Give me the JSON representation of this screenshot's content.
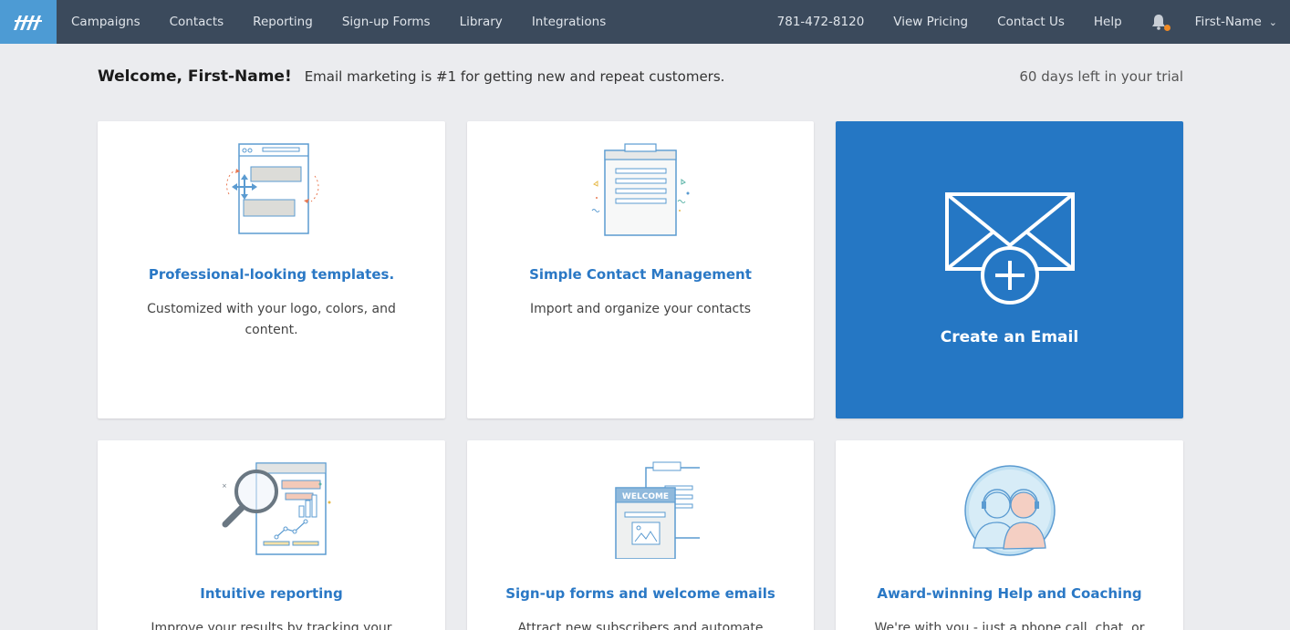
{
  "nav": {
    "left": [
      "Campaigns",
      "Contacts",
      "Reporting",
      "Sign-up Forms",
      "Library",
      "Integrations"
    ],
    "phone": "781-472-8120",
    "view_pricing": "View Pricing",
    "contact_us": "Contact Us",
    "help": "Help",
    "user": "First-Name",
    "logo_color": "#4d9bd4",
    "bar_color": "#3b4a5c",
    "notification_dot_color": "#f08a24"
  },
  "welcome": {
    "title": "Welcome, First-Name!",
    "subtitle": "Email marketing is #1 for getting new and repeat customers.",
    "trial": "60 days left in your trial"
  },
  "cards": {
    "templates": {
      "title": "Professional-looking templates.",
      "desc": "Customized with your logo, colors, and content.",
      "icon": "template-editor-icon"
    },
    "contacts": {
      "title": "Simple Contact Management",
      "desc": "Import and organize your contacts",
      "icon": "clipboard-list-icon"
    },
    "create": {
      "title": "Create an Email",
      "icon": "envelope-plus-icon",
      "color": "#2577c4"
    },
    "reporting": {
      "title": "Intuitive reporting",
      "desc": "Improve your results by tracking your opens",
      "icon": "magnifier-report-icon"
    },
    "signup": {
      "title": "Sign-up forms and welcome emails",
      "desc": "Attract new subscribers and automate",
      "icon": "welcome-form-icon",
      "badge": "WELCOME"
    },
    "help": {
      "title": "Award-winning Help and Coaching",
      "desc": "We're with you - just a phone call, chat, or",
      "icon": "support-agents-icon"
    }
  }
}
